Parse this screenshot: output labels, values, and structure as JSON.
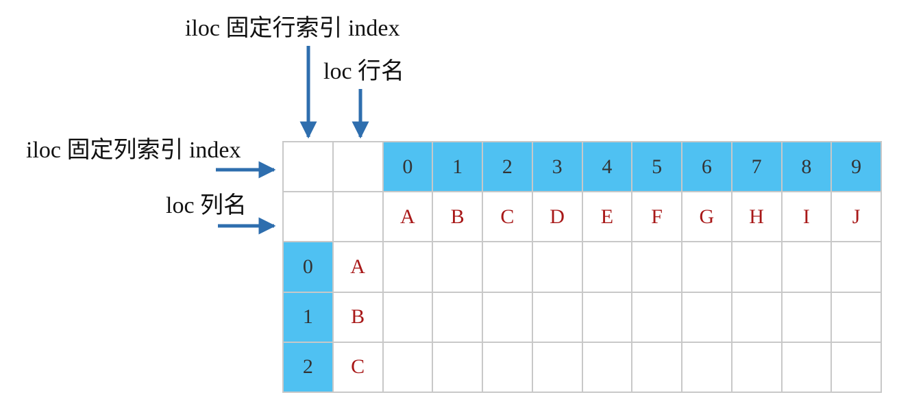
{
  "labels": {
    "iloc_row": "iloc 固定行索引 index",
    "loc_row": "loc 行名",
    "iloc_col": "iloc 固定列索引 index",
    "loc_col": "loc 列名"
  },
  "column_index": [
    "0",
    "1",
    "2",
    "3",
    "4",
    "5",
    "6",
    "7",
    "8",
    "9"
  ],
  "column_names": [
    "A",
    "B",
    "C",
    "D",
    "E",
    "F",
    "G",
    "H",
    "I",
    "J"
  ],
  "row_index": [
    "0",
    "1",
    "2"
  ],
  "row_names": [
    "A",
    "B",
    "C"
  ],
  "colors": {
    "highlight": "#4fc1f2",
    "name_text": "#a81818",
    "arrow": "#2e6eae",
    "grid_line": "#c8c8c8"
  }
}
